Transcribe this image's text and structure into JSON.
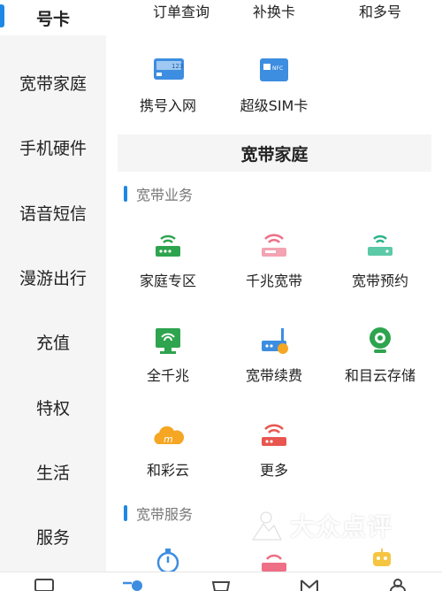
{
  "sidebar": {
    "items": [
      {
        "label": "号卡",
        "active": true
      },
      {
        "label": "宽带家庭"
      },
      {
        "label": "手机硬件"
      },
      {
        "label": "语音短信"
      },
      {
        "label": "漫游出行"
      },
      {
        "label": "充值"
      },
      {
        "label": "特权"
      },
      {
        "label": "生活"
      },
      {
        "label": "服务"
      }
    ],
    "accent_color": "#1e88e5"
  },
  "top_links": [
    "订单查询",
    "补换卡",
    "和多号"
  ],
  "card_items": [
    {
      "label": "携号入网",
      "icon": "sim-card-123-icon",
      "icon_text": "123"
    },
    {
      "label": "超级SIM卡",
      "icon": "nfc-sim-card-icon",
      "icon_text": "NFC"
    }
  ],
  "section": {
    "title": "宽带家庭"
  },
  "broadband_business": {
    "heading": "宽带业务",
    "items": [
      {
        "label": "家庭专区",
        "icon": "green-router-icon"
      },
      {
        "label": "千兆宽带",
        "icon": "pink-router-icon"
      },
      {
        "label": "宽带预约",
        "icon": "teal-router-icon"
      },
      {
        "label": "全千兆",
        "icon": "green-monitor-wifi-icon"
      },
      {
        "label": "宽带续费",
        "icon": "blue-router-icon"
      },
      {
        "label": "和目云存储",
        "icon": "green-camera-icon"
      },
      {
        "label": "和彩云",
        "icon": "orange-cloud-icon"
      },
      {
        "label": "更多",
        "icon": "red-router-icon"
      }
    ]
  },
  "broadband_service": {
    "heading": "宽带服务",
    "icons": [
      "blue-stopwatch-icon",
      "pink-router-icon",
      "yellow-robot-icon"
    ]
  },
  "watermark": {
    "text": "大众点评"
  },
  "bottom_tabs": [
    "home-tab-icon",
    "service-tab-icon",
    "shop-tab-icon",
    "discover-tab-icon",
    "mine-tab-icon"
  ]
}
